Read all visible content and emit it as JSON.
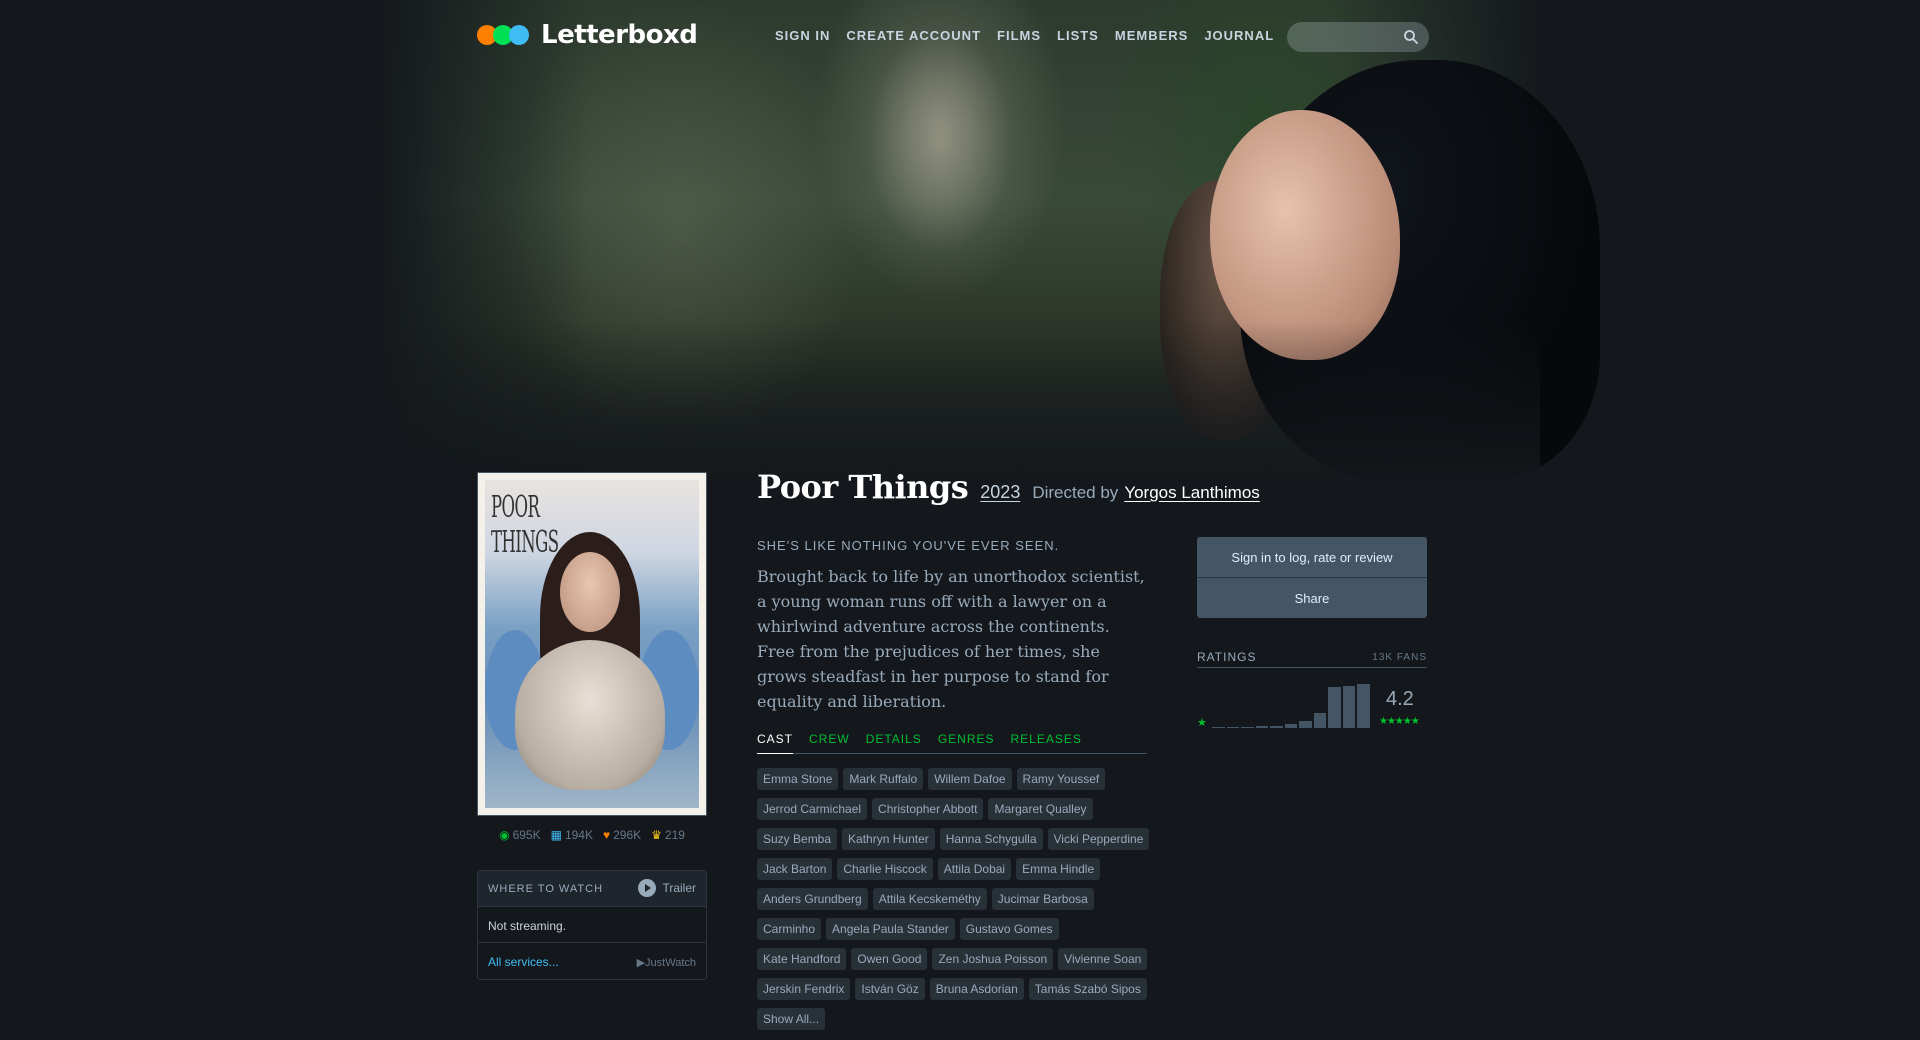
{
  "header": {
    "logo_text": "Letterboxd",
    "logo_colors": [
      "#ff8000",
      "#00e054",
      "#40bcf4"
    ],
    "nav": [
      "SIGN IN",
      "CREATE ACCOUNT",
      "FILMS",
      "LISTS",
      "MEMBERS",
      "JOURNAL"
    ]
  },
  "film": {
    "title": "Poor Things",
    "year": "2023",
    "directed_by_label": "Directed by",
    "director": "Yorgos Lanthimos",
    "tagline": "SHE'S LIKE NOTHING YOU'VE EVER SEEN.",
    "synopsis": "Brought back to life by an unorthodox scientist, a young woman runs off with a lawyer on a whirlwind adventure across the continents. Free from the prejudices of her times, she grows steadfast in her purpose to stand for equality and liberation.",
    "poster_text": "POOR THINGS"
  },
  "stats": {
    "watched": "695K",
    "lists": "194K",
    "likes": "296K",
    "top": "219"
  },
  "watch": {
    "title": "WHERE TO WATCH",
    "trailer": "Trailer",
    "status": "Not streaming.",
    "all_services": "All services...",
    "provider": "JustWatch"
  },
  "tabs": [
    "CAST",
    "CREW",
    "DETAILS",
    "GENRES",
    "RELEASES"
  ],
  "cast": [
    "Emma Stone",
    "Mark Ruffalo",
    "Willem Dafoe",
    "Ramy Youssef",
    "Jerrod Carmichael",
    "Christopher Abbott",
    "Margaret Qualley",
    "Suzy Bemba",
    "Kathryn Hunter",
    "Hanna Schygulla",
    "Vicki Pepperdine",
    "Jack Barton",
    "Charlie Hiscock",
    "Attila Dobai",
    "Emma Hindle",
    "Anders Grundberg",
    "Attila Kecskeméthy",
    "Jucimar Barbosa",
    "Carminho",
    "Angela Paula Stander",
    "Gustavo Gomes",
    "Kate Handford",
    "Owen Good",
    "Zen Joshua Poisson",
    "Vivienne Soan",
    "Jerskin Fendrix",
    "István Göz",
    "Bruna Asdorian",
    "Tamás Szabó Sipos",
    "Show All..."
  ],
  "sidebar": {
    "sign_in": "Sign in to log, rate or review",
    "share": "Share"
  },
  "ratings": {
    "title": "RATINGS",
    "fans": "13K FANS",
    "average": "4.2",
    "low_star": "★",
    "high_stars": "★★★★★",
    "histogram": [
      0.01,
      0.02,
      0.02,
      0.03,
      0.04,
      0.06,
      0.12,
      0.25,
      0.7,
      0.72,
      0.75
    ]
  }
}
